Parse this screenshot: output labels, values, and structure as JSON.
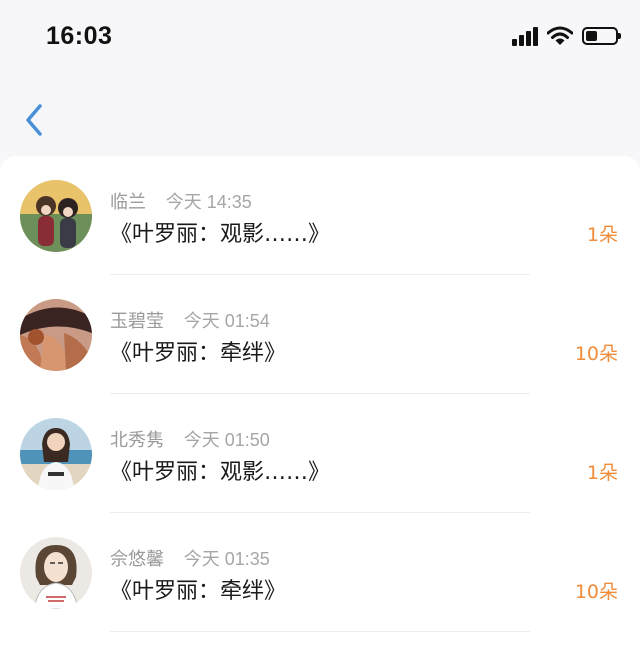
{
  "status_bar": {
    "time": "16:03",
    "icons": [
      "signal-icon",
      "wifi-icon",
      "battery-icon"
    ]
  },
  "nav": {
    "back_icon": "chevron-left-icon",
    "accent": "#4a90d9"
  },
  "colors": {
    "gift": "#f08c3a",
    "meta": "#9a9a9a",
    "title": "#1a1a1a"
  },
  "items": [
    {
      "name": "临兰",
      "time": "今天 14:35",
      "title": "《叶罗丽：观影……》",
      "gift": "1朵"
    },
    {
      "name": "玉碧莹",
      "time": "今天 01:54",
      "title": "《叶罗丽：牵绊》",
      "gift": "10朵"
    },
    {
      "name": "北秀隽",
      "time": "今天 01:50",
      "title": "《叶罗丽：观影……》",
      "gift": "1朵"
    },
    {
      "name": "佘悠馨",
      "time": "今天 01:35",
      "title": "《叶罗丽：牵绊》",
      "gift": "10朵"
    }
  ]
}
